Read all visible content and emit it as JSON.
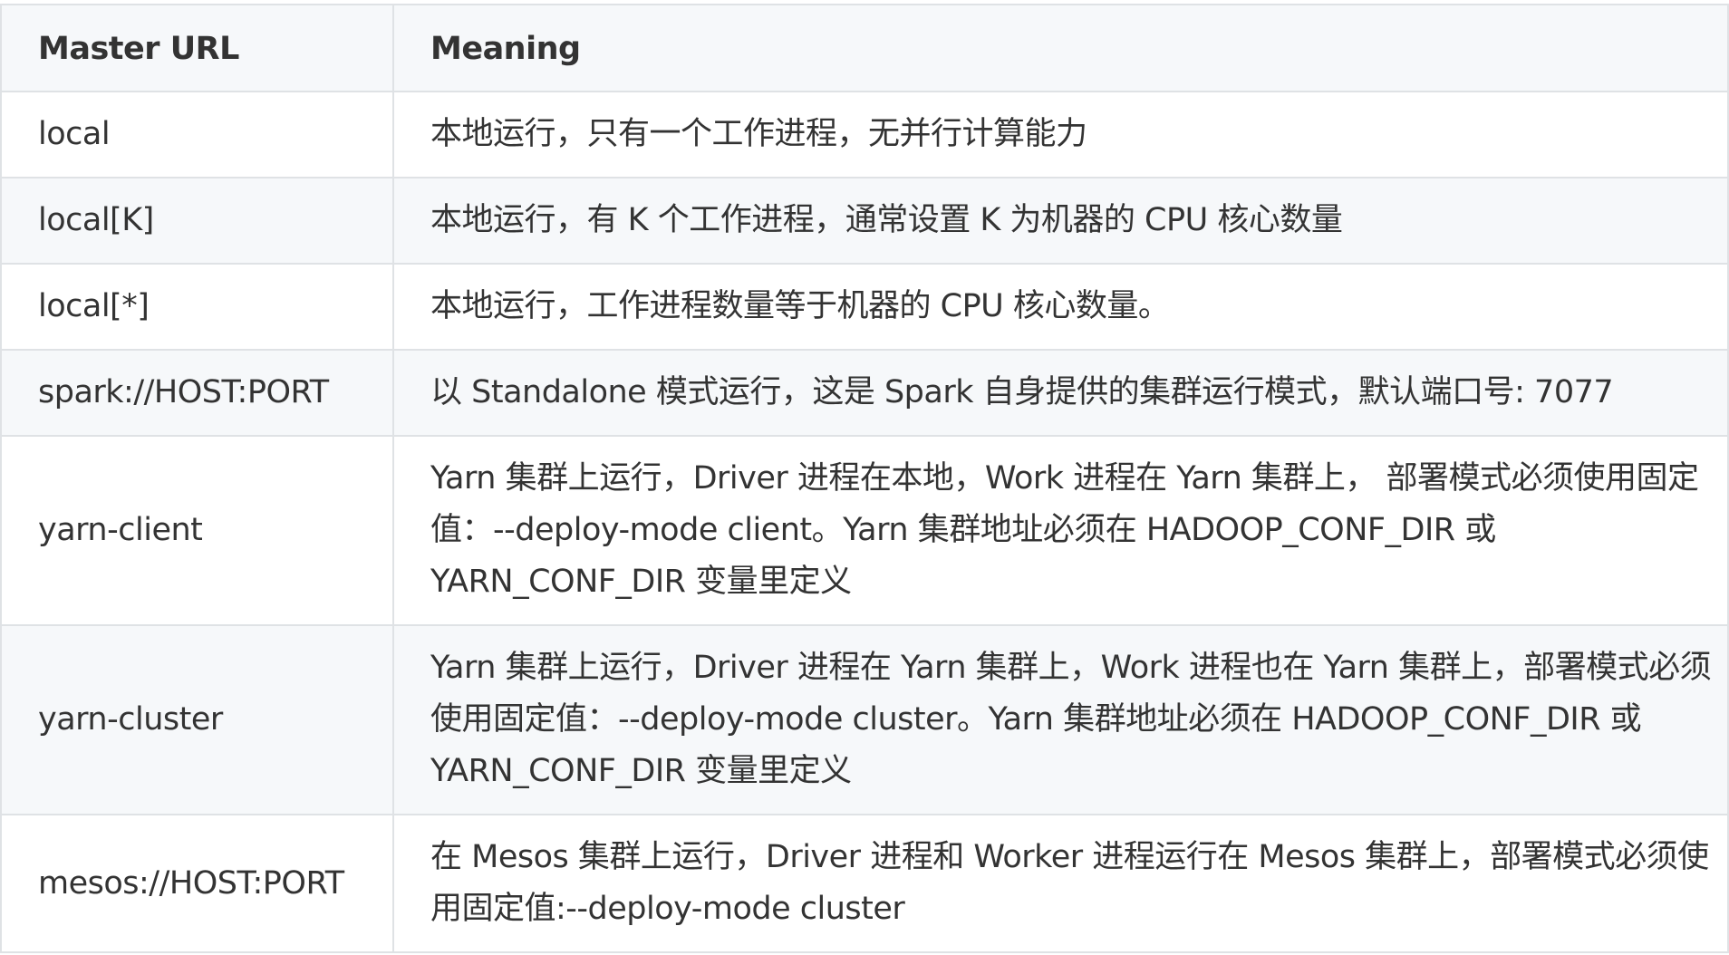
{
  "table": {
    "headers": [
      "Master URL",
      "Meaning"
    ],
    "rows": [
      {
        "url": "local",
        "meaning": "本地运行，只有一个工作进程，无并行计算能力"
      },
      {
        "url": "local[K]",
        "meaning": "本地运行，有 K 个工作进程，通常设置 K 为机器的 CPU 核心数量"
      },
      {
        "url": "local[*]",
        "meaning": "本地运行，工作进程数量等于机器的 CPU 核心数量。"
      },
      {
        "url": "spark://HOST:PORT",
        "meaning": "以 Standalone 模式运行，这是 Spark 自身提供的集群运行模式，默认端口号: 7077"
      },
      {
        "url": "yarn-client",
        "meaning": "Yarn 集群上运行，Driver 进程在本地，Work 进程在 Yarn 集群上， 部署模式必须使用固定值：--deploy-mode client。Yarn 集群地址必须在 HADOOP_CONF_DIR 或 YARN_CONF_DIR 变量里定义"
      },
      {
        "url": "yarn-cluster",
        "meaning": "Yarn 集群上运行，Driver 进程在 Yarn 集群上，Work 进程也在 Yarn 集群上，部署模式必须使用固定值：--deploy-mode cluster。Yarn 集群地址必须在 HADOOP_CONF_DIR 或 YARN_CONF_DIR 变量里定义"
      },
      {
        "url": "mesos://HOST:PORT",
        "meaning": "在 Mesos 集群上运行，Driver 进程和 Worker 进程运行在 Mesos 集群上，部署模式必须使用固定值:--deploy-mode cluster"
      }
    ]
  }
}
